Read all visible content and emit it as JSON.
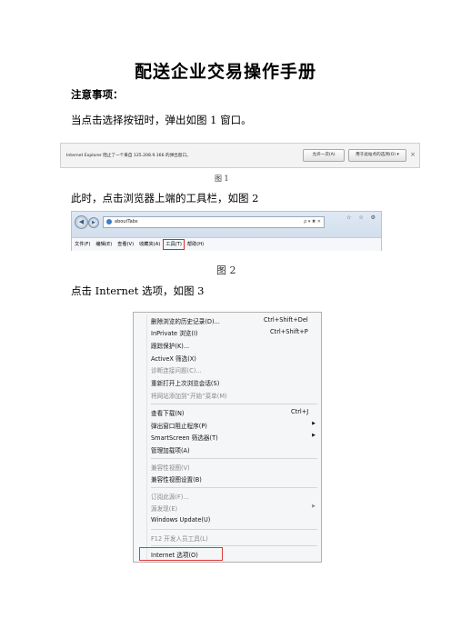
{
  "doc": {
    "title": "配送企业交易操作手册",
    "note_heading": "注意事项：",
    "para1": "当点击选择按钮时，弹出如图 1 窗口。",
    "cap1": "图 1",
    "para2": "此时，点击浏览器上端的工具栏，如图 2",
    "cap2": "图 2",
    "para3": "点击 Internet 选项，如图 3"
  },
  "infobar": {
    "message": "Internet Explorer 阻止了一个来自 125.208.9.166 的弹出窗口。",
    "allow_once": "允许一次(A)",
    "options": "用于此站点的选项(O) ▾",
    "close": "×"
  },
  "browser": {
    "tab_title": "aboutTabs",
    "address_tools": "ρ ▾ ✖ ✕",
    "window_controls": "☆ ☆ ⚙",
    "menus": [
      "文件(F)",
      "编辑(E)",
      "查看(V)",
      "收藏夹(A)",
      "工具(T)",
      "帮助(H)"
    ]
  },
  "tools_menu": {
    "items": [
      {
        "label": "删除浏览的历史记录(D)...",
        "shortcut": "Ctrl+Shift+Del",
        "disabled": false
      },
      {
        "label": "InPrivate 浏览(I)",
        "shortcut": "Ctrl+Shift+P",
        "disabled": false
      },
      {
        "label": "跟踪保护(K)...",
        "shortcut": "",
        "disabled": false
      },
      {
        "label": "ActiveX 筛选(X)",
        "shortcut": "",
        "disabled": false
      },
      {
        "label": "诊断连接问题(C)...",
        "shortcut": "",
        "disabled": true
      },
      {
        "label": "重新打开上次浏览会话(S)",
        "shortcut": "",
        "disabled": false
      },
      {
        "label": "将网站添加到“开始”菜单(M)",
        "shortcut": "",
        "disabled": true
      },
      {
        "label": "查看下载(N)",
        "shortcut": "Ctrl+J",
        "disabled": false
      },
      {
        "label": "弹出窗口阻止程序(P)",
        "shortcut": "",
        "disabled": false
      },
      {
        "label": "SmartScreen 筛选器(T)",
        "shortcut": "",
        "disabled": false
      },
      {
        "label": "管理加载项(A)",
        "shortcut": "",
        "disabled": false
      },
      {
        "label": "兼容性视图(V)",
        "shortcut": "",
        "disabled": true
      },
      {
        "label": "兼容性视图设置(B)",
        "shortcut": "",
        "disabled": false
      },
      {
        "label": "订阅此源(F)...",
        "shortcut": "",
        "disabled": true
      },
      {
        "label": "源发现(E)",
        "shortcut": "",
        "disabled": true
      },
      {
        "label": "Windows Update(U)",
        "shortcut": "",
        "disabled": false
      },
      {
        "label": "F12 开发人员工具(L)",
        "shortcut": "",
        "disabled": true
      },
      {
        "label": "Internet 选项(O)",
        "shortcut": "",
        "disabled": false
      }
    ]
  },
  "colors": {
    "highlight_box": "#e03a3a"
  }
}
